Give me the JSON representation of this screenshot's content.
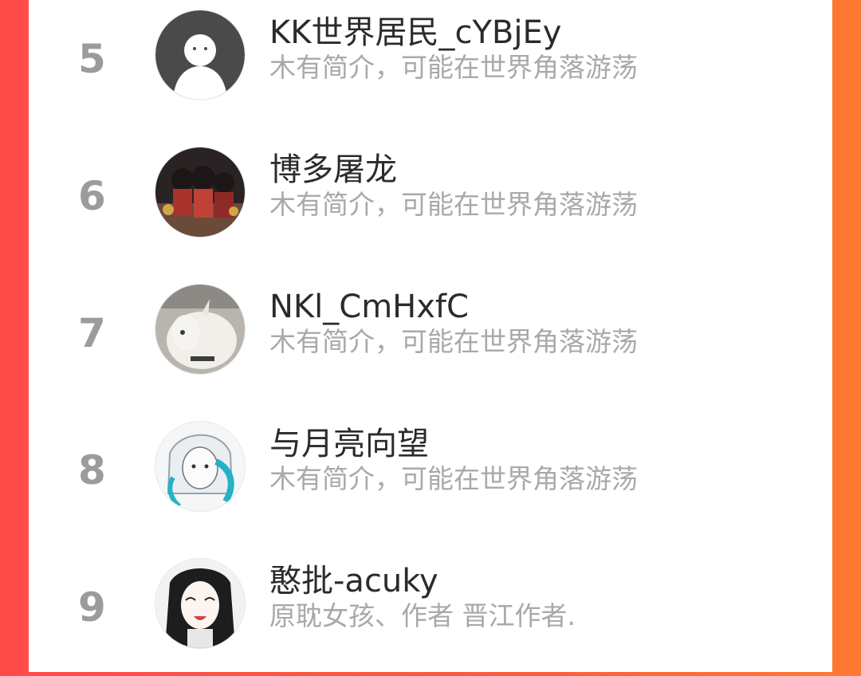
{
  "list": {
    "items": [
      {
        "rank": "5",
        "name": "KK世界居民_cYBjEy",
        "bio": "木有简介，可能在世界角落游荡",
        "avatar_icon": "default-person-avatar-icon"
      },
      {
        "rank": "6",
        "name": "博多屠龙",
        "bio": "木有简介，可能在世界角落游荡",
        "avatar_icon": "group-illustration-avatar-icon"
      },
      {
        "rank": "7",
        "name": "NKl_CmHxfC",
        "bio": "木有简介，可能在世界角落游荡",
        "avatar_icon": "goat-photo-avatar-icon"
      },
      {
        "rank": "8",
        "name": "与月亮向望",
        "bio": "木有简介，可能在世界角落游荡",
        "avatar_icon": "anime-character-avatar-icon"
      },
      {
        "rank": "9",
        "name": "憨批-acuky",
        "bio": "原耽女孩、作者 晋江作者.",
        "avatar_icon": "anime-girl-avatar-icon"
      }
    ]
  }
}
